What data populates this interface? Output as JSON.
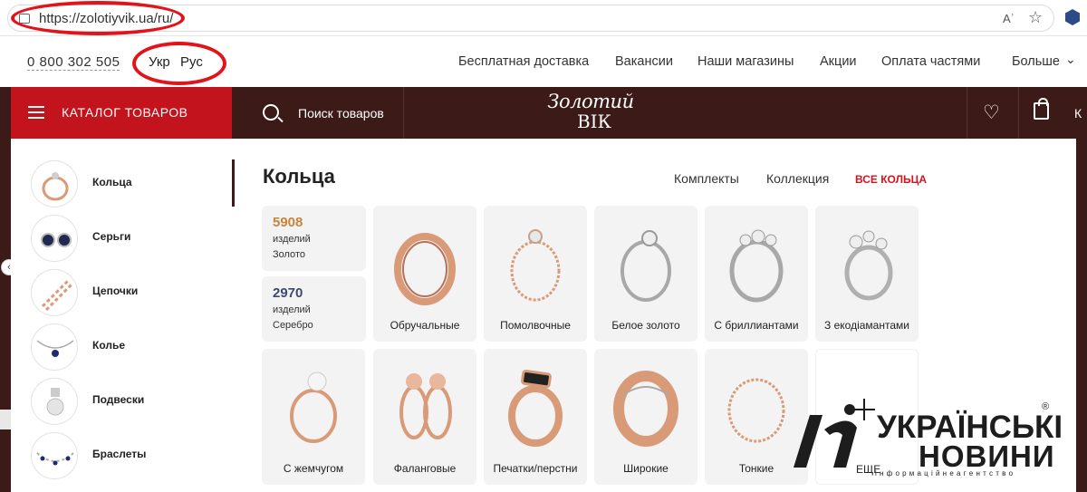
{
  "browser": {
    "url": "https://zolotiyvik.ua/ru/",
    "read_aloud": "Aʾ"
  },
  "topbar": {
    "phone": "0 800 302 505",
    "lang_ukr": "Укр",
    "lang_rus": "Рус",
    "nav": [
      "Бесплатная доставка",
      "Вакансии",
      "Наши магазины",
      "Акции",
      "Оплата частями",
      "Больше"
    ]
  },
  "header": {
    "catalog_label": "КАТАЛОГ ТОВАРОВ",
    "search_label": "Поиск товаров",
    "logo_top": "Золотий",
    "logo_bottom": "ВІК",
    "cart_text": "К"
  },
  "sidebar": {
    "items": [
      {
        "label": "Кольца",
        "icon": "ring-icon"
      },
      {
        "label": "Серьги",
        "icon": "earrings-icon"
      },
      {
        "label": "Цепочки",
        "icon": "chain-icon"
      },
      {
        "label": "Колье",
        "icon": "necklace-icon"
      },
      {
        "label": "Подвески",
        "icon": "pendant-icon"
      },
      {
        "label": "Браслеты",
        "icon": "bracelet-icon"
      }
    ]
  },
  "main": {
    "title": "Кольца",
    "sub_links": [
      "Комплекты",
      "Коллекция",
      "ВСЕ КОЛЬЦА"
    ],
    "stats": [
      {
        "count": "5908",
        "unit": "изделий",
        "metal": "Золото",
        "color": "#c8843c"
      },
      {
        "count": "2970",
        "unit": "изделий",
        "metal": "Серебро",
        "color": "#3c4a6e"
      }
    ],
    "row1": [
      {
        "label": "Обручальные",
        "metal": "gold"
      },
      {
        "label": "Помолвочные",
        "metal": "gold"
      },
      {
        "label": "Белое золото",
        "metal": "silver"
      },
      {
        "label": "С бриллиантами",
        "metal": "silver"
      },
      {
        "label": "З екодіамантами",
        "metal": "silver"
      }
    ],
    "row2": [
      {
        "label": "С жемчугом",
        "metal": "gold"
      },
      {
        "label": "Фаланговые",
        "metal": "gold"
      },
      {
        "label": "Печатки/перстни",
        "metal": "gold"
      },
      {
        "label": "Широкие",
        "metal": "gold"
      },
      {
        "label": "Тонкие",
        "metal": "gold"
      }
    ],
    "more_label": "ЕЩЕ"
  },
  "watermark": {
    "line1": "УКРАЇНСЬКІ",
    "line2": "НОВИНИ",
    "tagline": "і н ф о р м а ц і й н е   а г е н т с т в о",
    "reg": "®"
  },
  "colors": {
    "brand_dark": "#3b1a17",
    "brand_red": "#c3131c",
    "annotation_red": "#e2131b",
    "gold": "#d99a78",
    "silver": "#9a9a9a"
  }
}
